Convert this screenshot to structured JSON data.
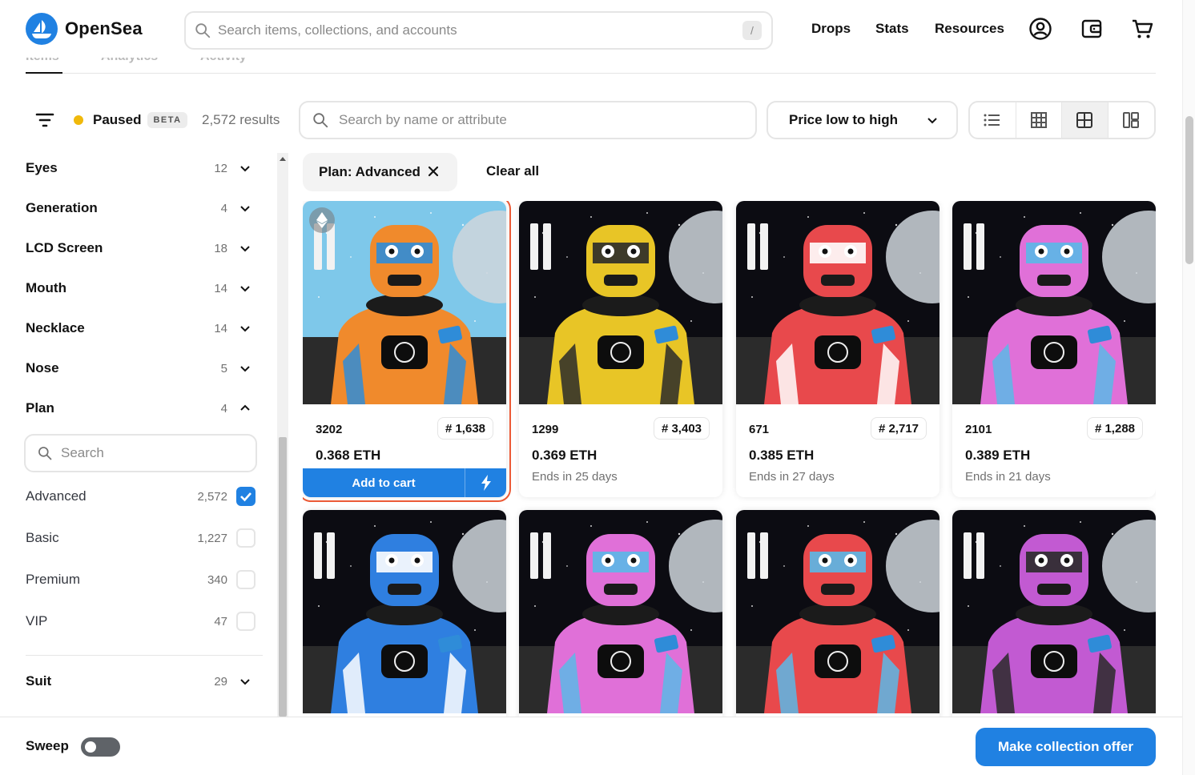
{
  "header": {
    "brand": "OpenSea",
    "search_placeholder": "Search items, collections, and accounts",
    "search_shortcut": "/",
    "nav": [
      "Drops",
      "Stats",
      "Resources"
    ],
    "icons": [
      "account-icon",
      "wallet-icon",
      "cart-icon"
    ]
  },
  "tabs": [
    "Items",
    "Analytics",
    "Activity"
  ],
  "toolbar": {
    "status": "Paused",
    "status_badge": "BETA",
    "status_color": "#f0b90b",
    "results": "2,572 results",
    "search_placeholder": "Search by name or attribute",
    "sort": "Price low to high",
    "views": [
      "list-view-icon",
      "grid-small-icon",
      "grid-large-icon",
      "grid-masonry-icon"
    ],
    "active_view": 2
  },
  "sidebar": {
    "facets": [
      {
        "name": "Eyes",
        "count": "12",
        "expanded": false
      },
      {
        "name": "Generation",
        "count": "4",
        "expanded": false
      },
      {
        "name": "LCD Screen",
        "count": "18",
        "expanded": false
      },
      {
        "name": "Mouth",
        "count": "14",
        "expanded": false
      },
      {
        "name": "Necklace",
        "count": "14",
        "expanded": false
      },
      {
        "name": "Nose",
        "count": "5",
        "expanded": false
      },
      {
        "name": "Plan",
        "count": "4",
        "expanded": true
      }
    ],
    "plan_search_placeholder": "Search",
    "plan_options": [
      {
        "label": "Advanced",
        "count": "2,572",
        "checked": true
      },
      {
        "label": "Basic",
        "count": "1,227",
        "checked": false
      },
      {
        "label": "Premium",
        "count": "340",
        "checked": false
      },
      {
        "label": "VIP",
        "count": "47",
        "checked": false
      }
    ],
    "after": [
      {
        "name": "Suit",
        "count": "29",
        "expanded": false
      }
    ]
  },
  "filters": {
    "chips": [
      "Plan: Advanced"
    ],
    "clear_all": "Clear all"
  },
  "cards": [
    {
      "token": "3202",
      "rank": "# 1,638",
      "price": "0.368 ETH",
      "ends": "",
      "selected": true,
      "cta_label": "Add to cart",
      "body": "#f08a2c",
      "accent": "#2f8cd8",
      "bg": "#7ec8ea"
    },
    {
      "token": "1299",
      "rank": "# 3,403",
      "price": "0.369 ETH",
      "ends": "Ends in 25 days",
      "selected": false,
      "body": "#e8c526",
      "accent": "#2a2a2a",
      "bg": "#0c0c12"
    },
    {
      "token": "671",
      "rank": "# 2,717",
      "price": "0.385 ETH",
      "ends": "Ends in 27 days",
      "selected": false,
      "body": "#e8494c",
      "accent": "#ffffff",
      "bg": "#0c0c12"
    },
    {
      "token": "2101",
      "rank": "# 1,288",
      "price": "0.389 ETH",
      "ends": "Ends in 21 days",
      "selected": false,
      "body": "#e070d8",
      "accent": "#5ab8e8",
      "bg": "#0c0c12"
    },
    {
      "token": "",
      "rank": "",
      "price": "",
      "ends": "",
      "selected": false,
      "body": "#2f7fe0",
      "accent": "#ffffff",
      "bg": "#0c0c12"
    },
    {
      "token": "",
      "rank": "",
      "price": "",
      "ends": "",
      "selected": false,
      "body": "#e070d8",
      "accent": "#5ab8e8",
      "bg": "#0c0c12"
    },
    {
      "token": "",
      "rank": "",
      "price": "",
      "ends": "",
      "selected": false,
      "body": "#e8494c",
      "accent": "#5ab8e8",
      "bg": "#0c0c12"
    },
    {
      "token": "",
      "rank": "",
      "price": "",
      "ends": "",
      "selected": false,
      "body": "#c25ad2",
      "accent": "#2a2a2a",
      "bg": "#0c0c12"
    }
  ],
  "footer": {
    "sweep": "Sweep",
    "sweep_on": false,
    "offer_button": "Make collection offer"
  },
  "colors": {
    "accent": "#2081e2",
    "selected_outline": "#eb5a36"
  }
}
